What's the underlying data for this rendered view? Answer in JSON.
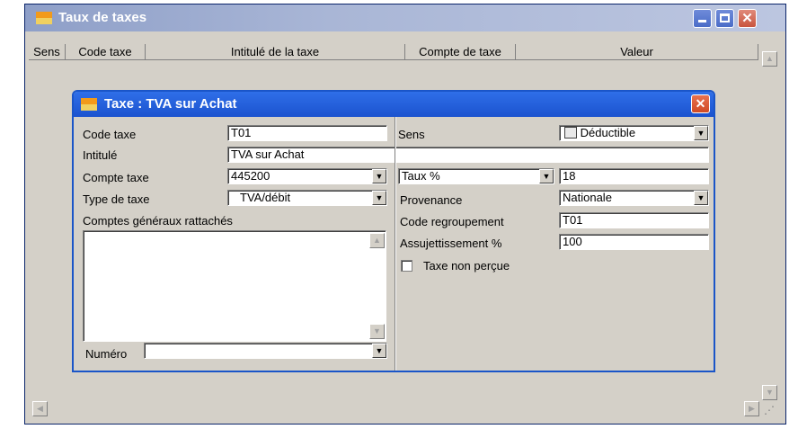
{
  "outer_window": {
    "title": "Taux de taxes",
    "columns": [
      "Sens",
      "Code taxe",
      "Intitulé de la taxe",
      "Compte de taxe",
      "Valeur"
    ]
  },
  "dialog": {
    "title": "Taxe : TVA sur Achat",
    "labels": {
      "code_taxe": "Code taxe",
      "intitule": "Intitulé",
      "compte_taxe": "Compte taxe",
      "type_taxe": "Type de taxe",
      "comptes_generaux": "Comptes généraux rattachés",
      "numero": "Numéro",
      "sens": "Sens",
      "provenance": "Provenance",
      "code_regroupement": "Code regroupement",
      "assujettissement": "Assujettissement %",
      "taxe_non_percue": "Taxe non perçue"
    },
    "values": {
      "code_taxe": "T01",
      "intitule": "TVA sur Achat",
      "compte_taxe": "445200",
      "type_taxe": "TVA/débit",
      "numero": "",
      "sens": "Déductible",
      "taux_type": "Taux %",
      "taux_value": "18",
      "provenance": "Nationale",
      "code_regroupement": "T01",
      "assujettissement": "100"
    },
    "taxe_non_percue_checked": false
  },
  "icons": {
    "app": "app-window-icon",
    "sens": "document-stack-icon"
  },
  "colors": {
    "outer_title_gradient": "#a9b6d6",
    "dialog_title_blue": "#1b53cf",
    "window_face": "#d4d0c8"
  }
}
